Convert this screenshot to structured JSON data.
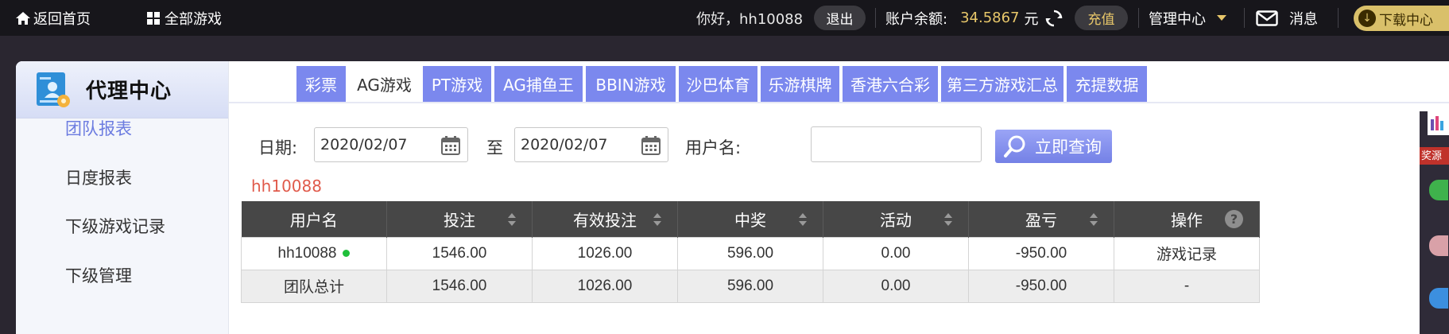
{
  "topbar": {
    "home": "返回首页",
    "all_games": "全部游戏",
    "greeting": "你好，hh10088",
    "logout": "退出",
    "balance_label": "账户余额:",
    "balance_value": "34.5867",
    "balance_unit": "元",
    "recharge": "充值",
    "manage_center": "管理中心",
    "messages": "消息",
    "download_center": "下载中心"
  },
  "sidebar": {
    "title": "代理中心",
    "items": [
      {
        "label": "团队报表",
        "active": true
      },
      {
        "label": "日度报表",
        "active": false
      },
      {
        "label": "下级游戏记录",
        "active": false
      },
      {
        "label": "下级管理",
        "active": false
      }
    ]
  },
  "tabs": [
    {
      "label": "彩票",
      "active": false
    },
    {
      "label": "AG游戏",
      "active": true
    },
    {
      "label": "PT游戏",
      "active": false
    },
    {
      "label": "AG捕鱼王",
      "active": false
    },
    {
      "label": "BBIN游戏",
      "active": false
    },
    {
      "label": "沙巴体育",
      "active": false
    },
    {
      "label": "乐游棋牌",
      "active": false
    },
    {
      "label": "香港六合彩",
      "active": false
    },
    {
      "label": "第三方游戏汇总",
      "active": false
    },
    {
      "label": "充提数据",
      "active": false
    }
  ],
  "filter": {
    "date_label": "日期:",
    "date_from": "2020/02/07",
    "to_label": "至",
    "date_to": "2020/02/07",
    "username_label": "用户名:",
    "username_value": "",
    "query_button": "立即查询"
  },
  "current_user": "hh10088",
  "table": {
    "headers": [
      "用户名",
      "投注",
      "有效投注",
      "中奖",
      "活动",
      "盈亏",
      "操作"
    ],
    "rows": [
      [
        "hh10088",
        "1546.00",
        "1026.00",
        "596.00",
        "0.00",
        "-950.00",
        "游戏记录"
      ],
      [
        "团队总计",
        "1546.00",
        "1026.00",
        "596.00",
        "0.00",
        "-950.00",
        "-"
      ]
    ]
  },
  "right_strip": {
    "tag": "奖源"
  },
  "colors": {
    "topbar_bg": "#17161b",
    "accent_gold": "#e8c76a",
    "tab_bg": "#7b88ee",
    "active_sidebar": "#6c7ce0",
    "username_red": "#e05a4b",
    "table_header": "#474747",
    "online_dot": "#1fbf3a"
  }
}
